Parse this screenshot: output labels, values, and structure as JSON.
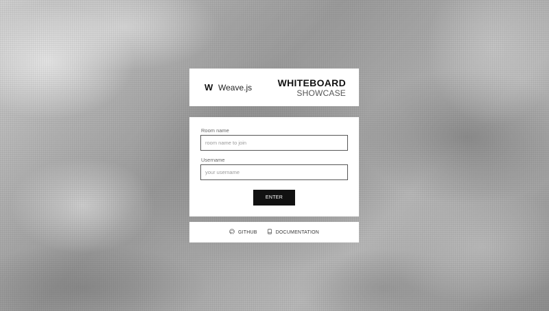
{
  "app": {
    "logo_mark": "W",
    "logo_name": "Weave.js",
    "title_main": "WHITEBOARD",
    "title_sub": "SHOWCASE"
  },
  "form": {
    "room_label": "Room name",
    "room_placeholder": "room name to join",
    "room_value": "",
    "username_label": "Username",
    "username_placeholder": "your username",
    "username_value": "",
    "enter_label": "ENTER"
  },
  "footer": {
    "links": [
      {
        "label": "GITHUB",
        "icon": "github-icon"
      },
      {
        "label": "DOCUMENTATION",
        "icon": "book-icon"
      }
    ]
  },
  "colors": {
    "button_bg": "#111111",
    "card_bg": "#ffffff"
  }
}
